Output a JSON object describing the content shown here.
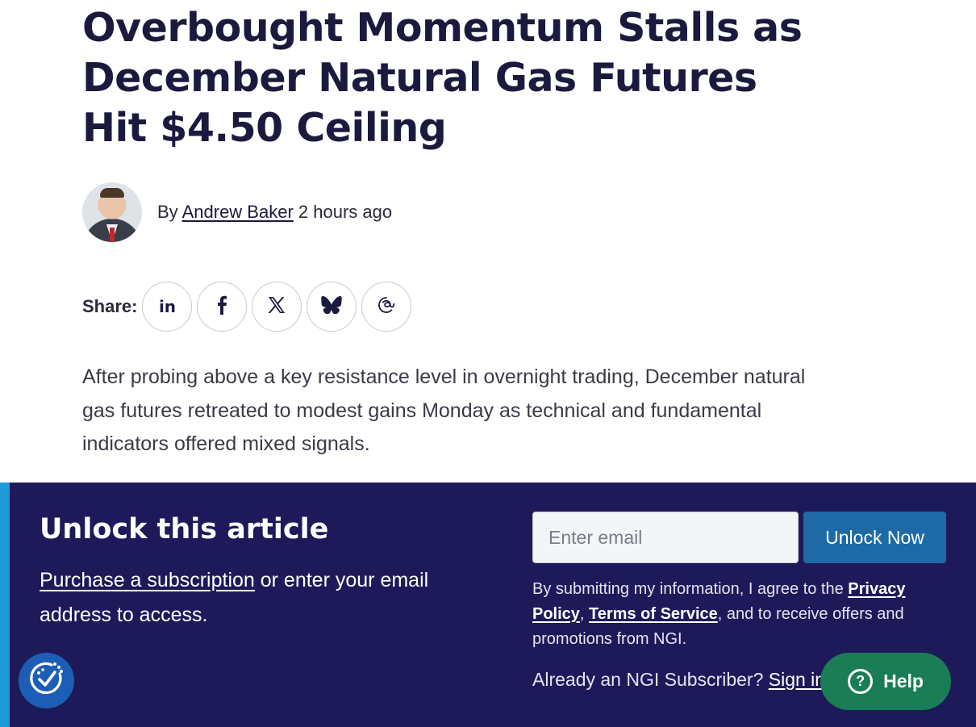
{
  "article": {
    "headline": "Overbought Momentum Stalls as December Natural Gas Futures Hit $4.50 Ceiling",
    "byline_prefix": "By",
    "author": "Andrew Baker",
    "time_ago": "2 hours ago",
    "share_label": "Share:",
    "share_buttons": [
      {
        "name": "linkedin-icon",
        "glyph": "in"
      },
      {
        "name": "facebook-icon",
        "glyph": "f"
      },
      {
        "name": "x-twitter-icon",
        "glyph": "X"
      },
      {
        "name": "bluesky-icon",
        "glyph": "butterfly"
      },
      {
        "name": "threads-icon",
        "glyph": "@"
      }
    ],
    "lede": "After probing above a key resistance level in overnight trading, December natural gas futures retreated to modest gains Monday as technical and fundamental indicators offered mixed signals."
  },
  "paywall": {
    "title": "Unlock this article",
    "purchase_link": "Purchase a subscription",
    "desc_rest": " or enter your email address to access.",
    "email_placeholder": "Enter email",
    "unlock_button": "Unlock Now",
    "legal_prefix": "By submitting my information, I agree to the ",
    "privacy_link": "Privacy Policy",
    "legal_comma": ", ",
    "terms_link": "Terms of Service",
    "legal_suffix": ", and to receive offers and promotions from NGI.",
    "subscriber_prompt": "Already an NGI Subscriber? ",
    "signin_link": "Sign in"
  },
  "widgets": {
    "help_label": "Help",
    "help_glyph": "?"
  },
  "colors": {
    "paywall_bg": "#1e1a5a",
    "accent_bar": "#1e9ad6",
    "unlock_button": "#1e6aa6",
    "help_button": "#1a7d55",
    "a11y_button": "#1c5eb5"
  }
}
